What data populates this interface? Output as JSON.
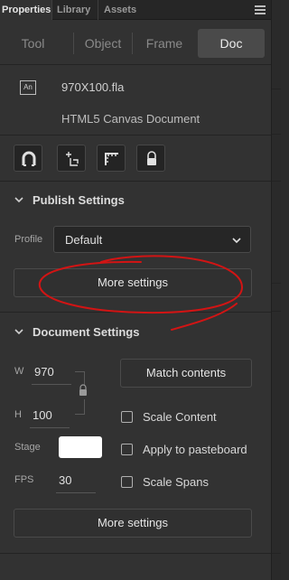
{
  "tabs": [
    {
      "label": "Properties",
      "active": true
    },
    {
      "label": "Library",
      "active": false
    },
    {
      "label": "Assets",
      "active": false
    }
  ],
  "segments": [
    {
      "label": "Tool",
      "active": false
    },
    {
      "label": "Object",
      "active": false
    },
    {
      "label": "Frame",
      "active": false
    },
    {
      "label": "Doc",
      "active": true
    }
  ],
  "document": {
    "icon_text": "An",
    "filename": "970X100.fla",
    "type": "HTML5 Canvas Document"
  },
  "toolbar_icons": [
    "magnet-icon",
    "snap-to-object-icon",
    "film-edit-icon",
    "lock-icon"
  ],
  "publish": {
    "title": "Publish Settings",
    "profile_label": "Profile",
    "profile_value": "Default",
    "more_settings": "More settings"
  },
  "docsettings": {
    "title": "Document Settings",
    "w_label": "W",
    "w_value": "970",
    "h_label": "H",
    "h_value": "100",
    "match_contents": "Match contents",
    "stage_label": "Stage",
    "stage_color": "#ffffff",
    "fps_label": "FPS",
    "fps_value": "30",
    "checkboxes": [
      {
        "label": "Scale Content",
        "checked": false
      },
      {
        "label": "Apply to pasteboard",
        "checked": false
      },
      {
        "label": "Scale Spans",
        "checked": false
      }
    ],
    "more_settings": "More settings"
  },
  "colors": {
    "annotation": "#d21414",
    "panel_bg": "#323232"
  }
}
